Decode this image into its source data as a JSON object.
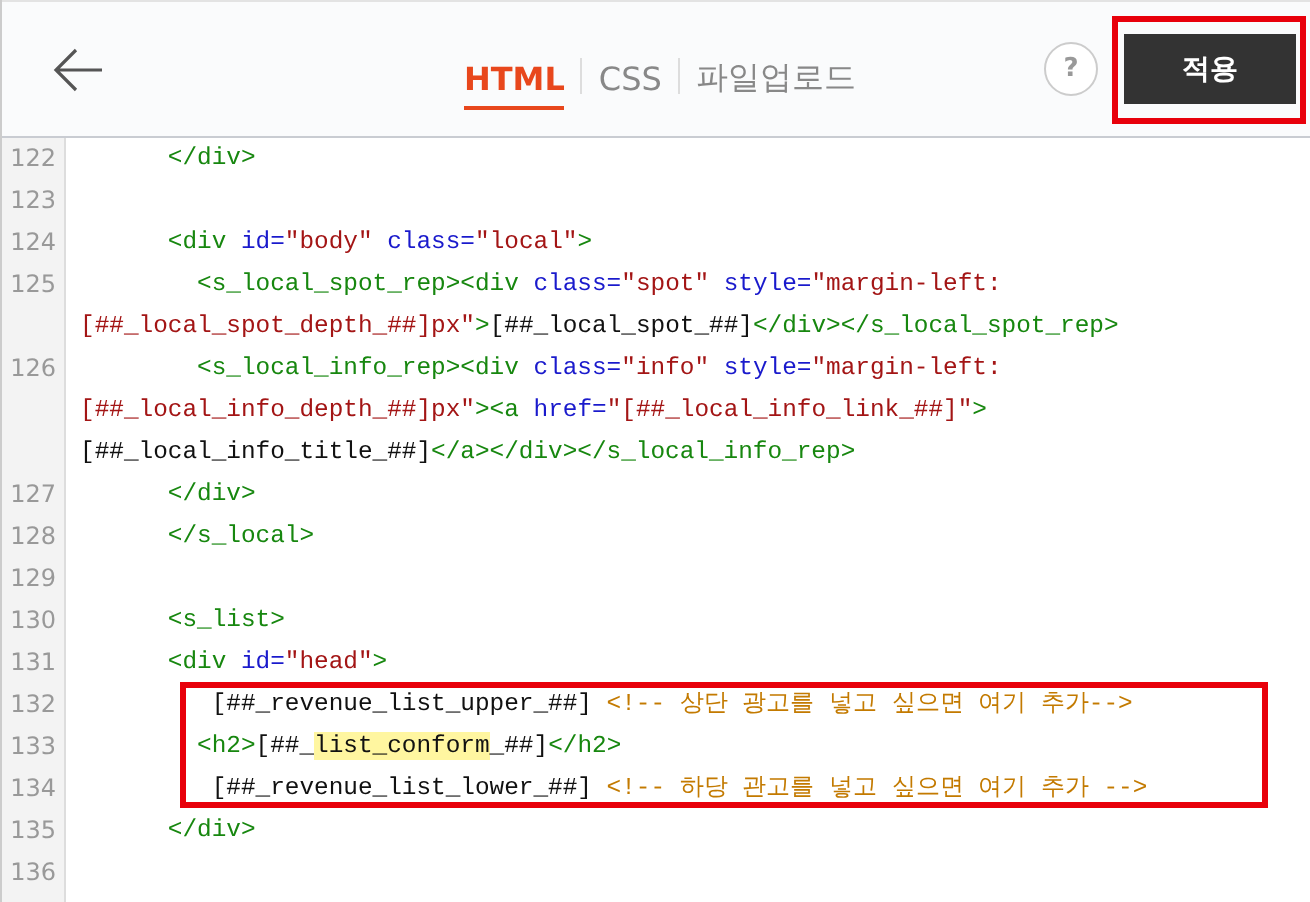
{
  "header": {
    "tabs": [
      {
        "label": "HTML",
        "selected": true
      },
      {
        "label": "CSS",
        "selected": false
      },
      {
        "label": "파일업로드",
        "selected": false
      }
    ],
    "help_button": "?",
    "apply_button": {
      "label": "적용",
      "annotated": true
    }
  },
  "editor": {
    "lines": [
      {
        "number": "122",
        "boxed": false,
        "rows": [
          {
            "segments": [
              {
                "kind": "tag",
                "text": "      </div>"
              }
            ]
          }
        ]
      },
      {
        "number": "123",
        "boxed": false
      },
      {
        "number": "124",
        "boxed": false,
        "rows": [
          {
            "segments": [
              {
                "kind": "tag",
                "text": "      <div"
              },
              {
                "kind": "attr",
                "text": " id="
              },
              {
                "kind": "value",
                "text": "\"body\""
              },
              {
                "kind": "attr",
                "text": " class="
              },
              {
                "kind": "value",
                "text": "\"local\""
              },
              {
                "kind": "tag",
                "text": ">"
              }
            ]
          }
        ]
      },
      {
        "number": "125",
        "boxed": false,
        "rows": [
          {
            "segments": [
              {
                "kind": "tag",
                "text": "        <s_local_spot_rep><div"
              },
              {
                "kind": "attr",
                "text": " class="
              },
              {
                "kind": "value",
                "text": "\"spot\""
              },
              {
                "kind": "attr",
                "text": " style="
              },
              {
                "kind": "value",
                "text": "\"margin-left:"
              }
            ]
          },
          {
            "segments": [
              {
                "kind": "value",
                "text": "[##_local_spot_depth_##]px\""
              },
              {
                "kind": "tag",
                "text": ">"
              },
              {
                "kind": "text",
                "text": "[##_local_spot_##]"
              },
              {
                "kind": "tag",
                "text": "</div></s_local_spot_rep>"
              }
            ]
          }
        ]
      },
      {
        "number": "126",
        "boxed": false,
        "rows": [
          {
            "segments": [
              {
                "kind": "tag",
                "text": "        <s_local_info_rep><div"
              },
              {
                "kind": "attr",
                "text": " class="
              },
              {
                "kind": "value",
                "text": "\"info\""
              },
              {
                "kind": "attr",
                "text": " style="
              },
              {
                "kind": "value",
                "text": "\"margin-left:"
              }
            ]
          },
          {
            "segments": [
              {
                "kind": "value",
                "text": "[##_local_info_depth_##]px\""
              },
              {
                "kind": "tag",
                "text": "><a"
              },
              {
                "kind": "attr",
                "text": " href="
              },
              {
                "kind": "value",
                "text": "\"[##_local_info_link_##]\""
              },
              {
                "kind": "tag",
                "text": ">"
              }
            ]
          },
          {
            "segments": [
              {
                "kind": "text",
                "text": "[##_local_info_title_##]"
              },
              {
                "kind": "tag",
                "text": "</a></div></s_local_info_rep>"
              }
            ]
          }
        ]
      },
      {
        "number": "127",
        "boxed": false,
        "rows": [
          {
            "segments": [
              {
                "kind": "tag",
                "text": "      </div>"
              }
            ]
          }
        ]
      },
      {
        "number": "128",
        "boxed": false,
        "rows": [
          {
            "segments": [
              {
                "kind": "tag",
                "text": "      </s_local>"
              }
            ]
          }
        ]
      },
      {
        "number": "129",
        "boxed": false
      },
      {
        "number": "130",
        "boxed": false,
        "rows": [
          {
            "segments": [
              {
                "kind": "tag",
                "text": "      <s_list>"
              }
            ]
          }
        ]
      },
      {
        "number": "131",
        "boxed": false,
        "rows": [
          {
            "segments": [
              {
                "kind": "tag",
                "text": "      <div"
              },
              {
                "kind": "attr",
                "text": " id="
              },
              {
                "kind": "value",
                "text": "\"head\""
              },
              {
                "kind": "tag",
                "text": ">"
              }
            ]
          }
        ]
      },
      {
        "number": "132",
        "boxed": true,
        "rows": [
          {
            "segments": [
              {
                "kind": "text",
                "text": "         [##_revenue_list_upper_##] "
              },
              {
                "kind": "comment",
                "text": "<!-- 상단 광고를 넣고 싶으면 여기 추가-->"
              }
            ]
          }
        ]
      },
      {
        "number": "133",
        "boxed": true,
        "rows": [
          {
            "segments": [
              {
                "kind": "tag",
                "text": "        <h2>"
              },
              {
                "kind": "text",
                "text": "[##_"
              },
              {
                "kind": "mark",
                "text": "list_conform"
              },
              {
                "kind": "text",
                "text": "_##]"
              },
              {
                "kind": "tag",
                "text": "</h2>"
              }
            ]
          }
        ]
      },
      {
        "number": "134",
        "boxed": true,
        "rows": [
          {
            "segments": [
              {
                "kind": "text",
                "text": "         [##_revenue_list_lower_##] "
              },
              {
                "kind": "comment",
                "text": "<!-- 하당 관고를 넣고 싶으면 여기 추가 -->"
              }
            ]
          }
        ]
      },
      {
        "number": "135",
        "boxed": false,
        "rows": [
          {
            "segments": [
              {
                "kind": "tag",
                "text": "      </div>"
              }
            ]
          }
        ]
      },
      {
        "number": "136",
        "boxed": false
      }
    ]
  }
}
